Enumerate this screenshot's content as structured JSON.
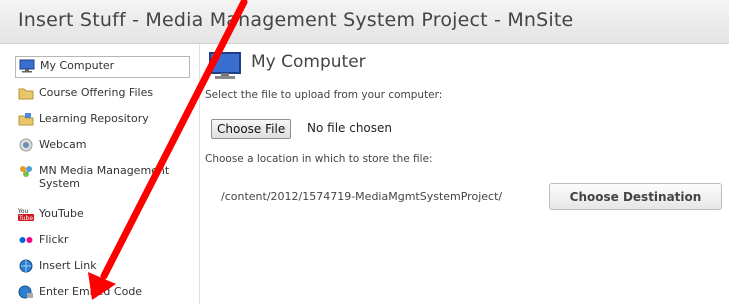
{
  "window": {
    "title": "Insert Stuff - Media Management System Project - MnSite"
  },
  "sidebar": {
    "items": [
      {
        "label": "My Computer",
        "icon": "monitor-icon",
        "selected": true
      },
      {
        "label": "Course Offering Files",
        "icon": "folder-icon"
      },
      {
        "label": "Learning Repository",
        "icon": "repository-icon"
      },
      {
        "label": "Webcam",
        "icon": "webcam-icon"
      },
      {
        "label": "MN Media Management System",
        "icon": "media-management-icon"
      },
      {
        "label": "YouTube",
        "icon": "youtube-icon"
      },
      {
        "label": "Flickr",
        "icon": "flickr-icon"
      },
      {
        "label": "Insert Link",
        "icon": "link-globe-icon"
      },
      {
        "label": "Enter Embed Code",
        "icon": "embed-icon"
      }
    ]
  },
  "main": {
    "title": "My Computer",
    "select_prompt": "Select the file to upload from your computer:",
    "choose_file_label": "Choose File",
    "file_status": "No file chosen",
    "location_prompt": "Choose a location in which to store the file:",
    "destination_path": "/content/2012/1574719-MediaMgmtSystemProject/",
    "choose_destination_label": "Choose Destination"
  },
  "colors": {
    "annotation_arrow": "#ff0000",
    "folder": "#e8c66a",
    "monitor": "#3a6fd1"
  }
}
